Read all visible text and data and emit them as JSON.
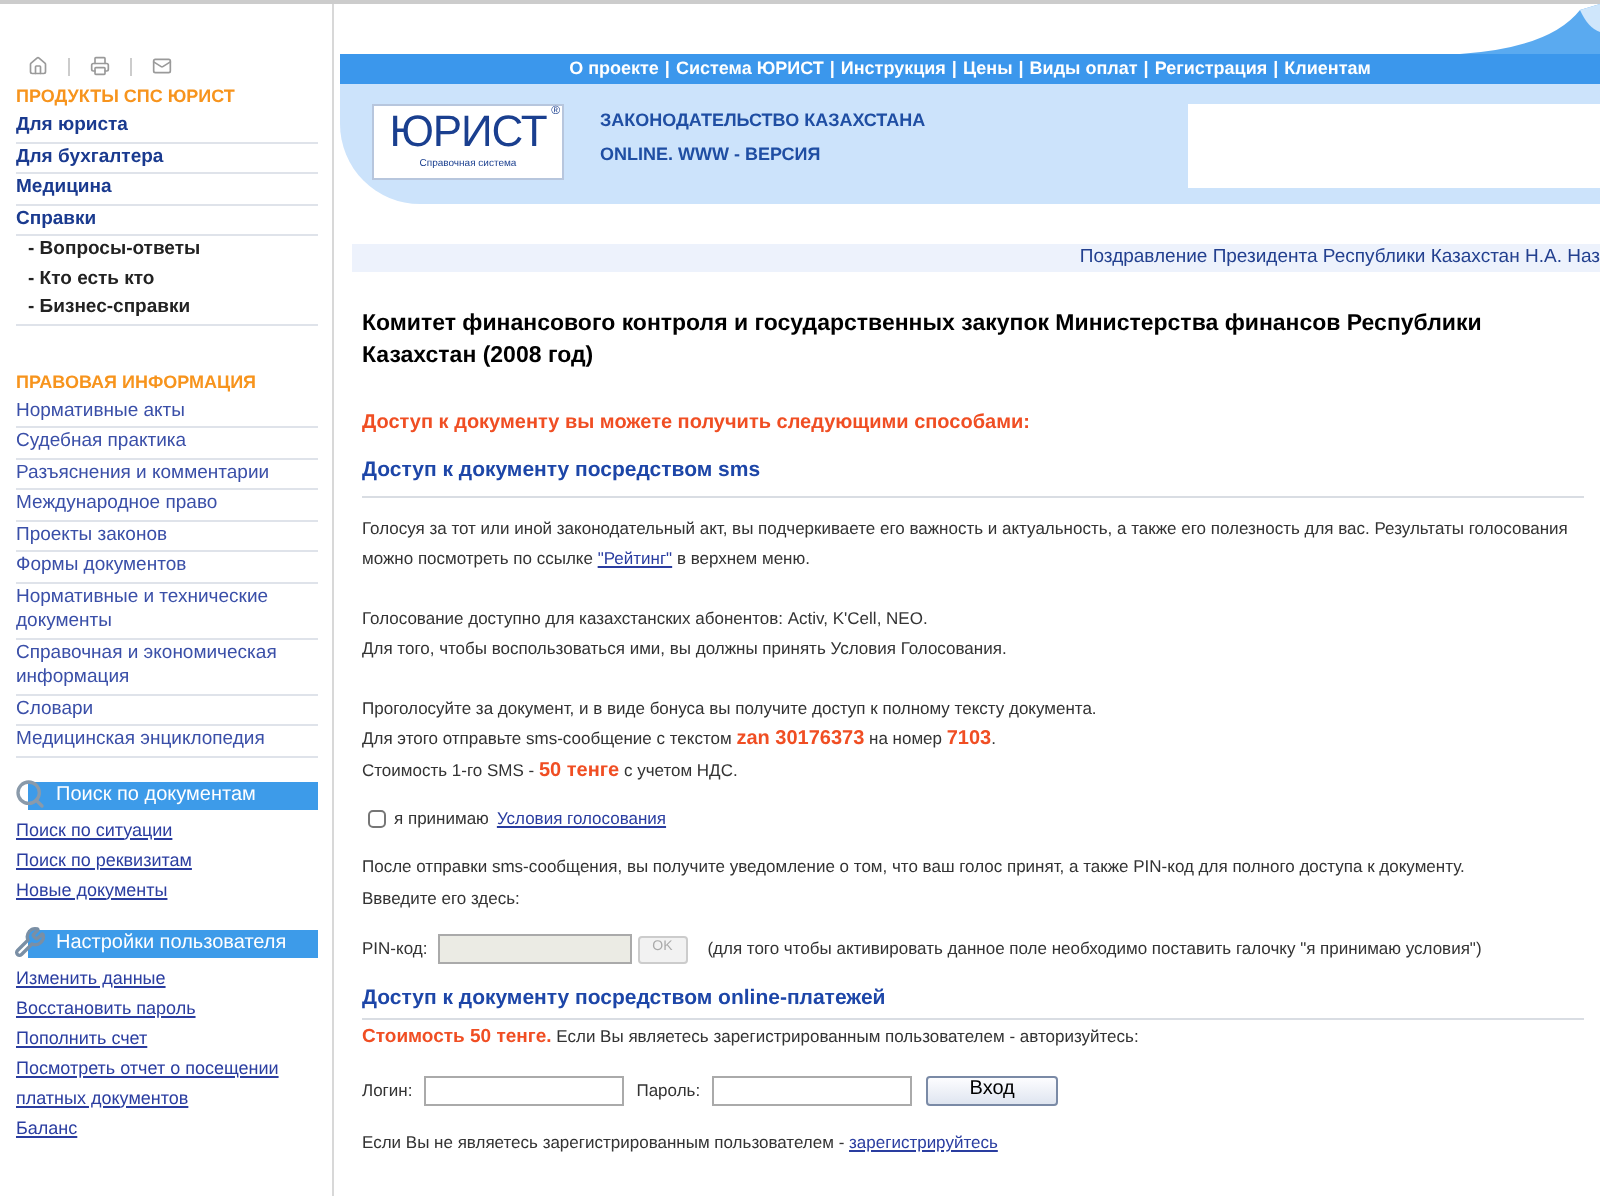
{
  "sidebar": {
    "products": {
      "title": "ПРОДУКТЫ СПС ЮРИСТ",
      "items": [
        {
          "label": "Для юриста",
          "kind": "main"
        },
        {
          "label": "Для бухгалтера",
          "kind": "main"
        },
        {
          "label": "Медицина",
          "kind": "main"
        },
        {
          "label": "Справки",
          "kind": "main"
        },
        {
          "label": "- Вопросы-ответы",
          "kind": "sub"
        },
        {
          "label": "- Кто есть кто",
          "kind": "sub"
        },
        {
          "label": "- Бизнес-справки",
          "kind": "sub"
        }
      ]
    },
    "legal": {
      "title": "ПРАВОВАЯ ИНФОРМАЦИЯ",
      "items": [
        "Нормативные акты",
        "Судебная практика",
        "Разъяснения и комментарии",
        "Международное право",
        "Проекты законов",
        "Формы документов",
        "Нормативные и технические документы",
        "Справочная и экономическая информация",
        "Словари",
        "Медицинская энциклопедия"
      ]
    },
    "panels": [
      {
        "kind": "search",
        "title": "Поиск по документам",
        "links": [
          "Поиск по ситуации",
          "Поиск по реквизитам",
          "Новые документы"
        ]
      },
      {
        "kind": "settings",
        "title": "Настройки пользователя",
        "links": [
          "Изменить данные",
          "Восстановить пароль",
          "Пополнить счет",
          "Посмотреть отчет о посещении платных документов",
          "Баланс"
        ]
      }
    ]
  },
  "header": {
    "nav": [
      "О проекте",
      "Система ЮРИСТ",
      "Инструкция",
      "Цены",
      "Виды оплат",
      "Регистрация",
      "Клиентам"
    ],
    "nav_separator": "|",
    "logo": {
      "name": "ЮРИСТ",
      "tagline": "Справочная система",
      "mark": "®"
    },
    "title_lines": [
      "ЗАКОНОДАТЕЛЬСТВО КАЗАХСТАНА",
      "ONLINE. WWW - ВЕРСИЯ"
    ],
    "ticker": "Поздравление Президента Республики Казахстан Н.А. Наз"
  },
  "document": {
    "title": "Комитет финансового контроля и государственных закупок Министерства финансов Республики Казахстан (2008 год)",
    "access_intro": "Доступ к документу вы можете получить следующими способами:",
    "sms": {
      "heading": "Доступ к документу посредством sms",
      "rating_paragraph": {
        "before": "Голосуя за тот или иной законодательный акт, вы подчеркиваете его важность и актуальность, а также его полезность для вас. Результаты голосования можно посмотреть по ссылке ",
        "link": "\"Рейтинг\"",
        "after": " в верхнем меню."
      },
      "paragraphs": [
        [
          "Голосование доступно для казахстанских абонентов: Activ, K'Cell, NEO.",
          "Для того, чтобы воспользоваться ими, вы должны принять Условия Голосования."
        ],
        [
          "Проголосуйте за документ, и в виде бонуса вы получите доступ к полному тексту документа.",
          "Для этого отправьте sms-сообщение с текстом **zan 30176373** на номер **7103**.",
          "Стоимость 1-го SMS - **50 тенге** с учетом НДС."
        ]
      ],
      "agree": {
        "checked": false,
        "label": "я принимаю",
        "link": "Условия голосования"
      },
      "after_paragraph": [
        "После отправки sms-сообщения, вы получите уведомление о том, что ваш голос принят, а также PIN-код для полного доступа к документу.",
        "Ввведите его здесь:"
      ],
      "pin": {
        "label": "PIN-код:",
        "disabled": true,
        "button": "OK",
        "note": "(для того чтобы активировать данное поле необходимо поставить галочку \"я принимаю условия\")"
      }
    },
    "online": {
      "heading": "Доступ к документу посредством online-платежей",
      "price_line": "**Стоимость 50 тенге.** Если Вы являетесь зарегистрированным пользователем - авторизуйтесь:",
      "login_label": "Логин:",
      "password_label": "Пароль:",
      "submit": "Вход",
      "register": {
        "before": "Если Вы не являетесь зарегистрированным пользователем - ",
        "link": "зарегистрируйтесь"
      }
    }
  }
}
